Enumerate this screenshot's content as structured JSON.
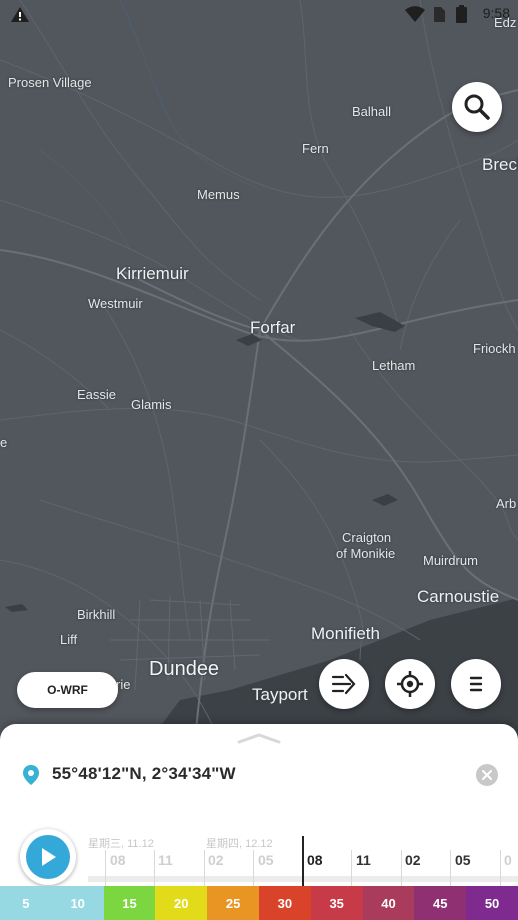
{
  "status_bar": {
    "time": "9:58",
    "icons": [
      "alert-triangle-icon",
      "wifi-icon",
      "sim-icon",
      "battery-icon"
    ]
  },
  "map": {
    "places": [
      {
        "name": "Edz",
        "cls": ""
      },
      {
        "name": "Prosen Village",
        "cls": ""
      },
      {
        "name": "Balhall",
        "cls": ""
      },
      {
        "name": "Brech",
        "cls": "big"
      },
      {
        "name": "Fern",
        "cls": ""
      },
      {
        "name": "Memus",
        "cls": ""
      },
      {
        "name": "Kirriemuir",
        "cls": "big"
      },
      {
        "name": "Westmuir",
        "cls": ""
      },
      {
        "name": "Forfar",
        "cls": "big"
      },
      {
        "name": "Friockh",
        "cls": ""
      },
      {
        "name": "Letham",
        "cls": ""
      },
      {
        "name": "Eassie",
        "cls": ""
      },
      {
        "name": "Glamis",
        "cls": ""
      },
      {
        "name": "e",
        "cls": ""
      },
      {
        "name": "Arb",
        "cls": ""
      },
      {
        "name": "Craigton",
        "cls": ""
      },
      {
        "name": "of Monikie",
        "cls": ""
      },
      {
        "name": "Muirdrum",
        "cls": ""
      },
      {
        "name": "Carnoustie",
        "cls": "big"
      },
      {
        "name": "Birkhill",
        "cls": ""
      },
      {
        "name": "Liff",
        "cls": ""
      },
      {
        "name": "Monifieth",
        "cls": "big"
      },
      {
        "name": "Dundee",
        "cls": "xl"
      },
      {
        "name": "rie",
        "cls": ""
      },
      {
        "name": "Tayport",
        "cls": "big"
      }
    ]
  },
  "controls": {
    "search_icon": "search-icon",
    "model_label": "O-WRF",
    "wind_icon": "wind-icon",
    "locate_icon": "crosshair-icon",
    "menu_icon": "menu-icon"
  },
  "sheet": {
    "coordinates": "55°48'12\"N, 2°34'34\"W",
    "pin_icon": "location-pin-icon",
    "clear_icon": "close-icon",
    "play_icon": "play-icon",
    "timeline": {
      "days": [
        "星期三, 11.12",
        "星期四, 12.12"
      ],
      "hours": [
        "08",
        "11",
        "02",
        "05",
        "08",
        "11",
        "02",
        "05",
        "0"
      ]
    }
  },
  "legend": {
    "values": [
      "5",
      "10",
      "15",
      "20",
      "25",
      "30",
      "35",
      "40",
      "45",
      "50"
    ],
    "colors": [
      "#97d9e3",
      "#97d9e3",
      "#7cd63f",
      "#e2db1a",
      "#e99524",
      "#d9432a",
      "#c73a48",
      "#a93b5c",
      "#8f3072",
      "#7e2a8e"
    ]
  }
}
